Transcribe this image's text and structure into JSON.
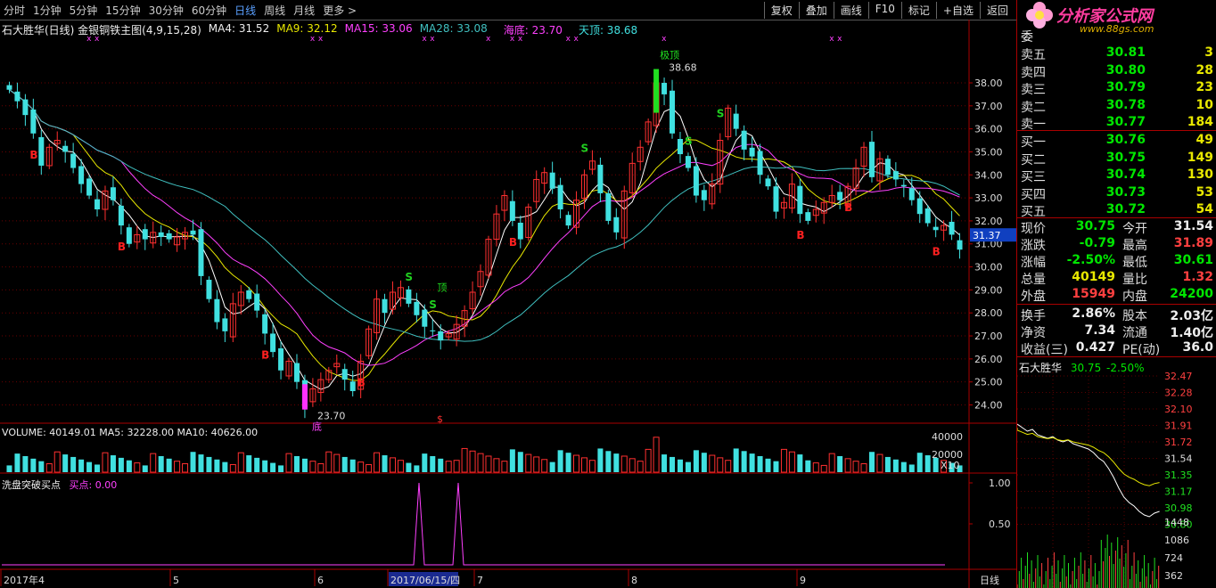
{
  "toolbar": {
    "periods": [
      "分时",
      "1分钟",
      "5分钟",
      "15分钟",
      "30分钟",
      "60分钟",
      "日线",
      "周线",
      "月线",
      "更多 >"
    ],
    "active_period": "日线",
    "buttons": [
      "复权",
      "叠加",
      "画线",
      "F10",
      "标记",
      "+自选",
      "返回"
    ]
  },
  "info": {
    "title": "石大胜华(日线) 金银铜铁主图(4,9,15,28)",
    "ma4": "MA4: 31.52",
    "ma9": "MA9: 32.12",
    "ma15": "MA15: 33.06",
    "ma28": "MA28: 33.08",
    "bottom": "海底: 23.70",
    "top": "天顶: 38.68"
  },
  "colors": {
    "up": "#ff3030",
    "down": "#40e0e0",
    "ma4": "#ffffff",
    "ma9": "#e8e800",
    "ma15": "#ff40ff",
    "ma28": "#40c0c0",
    "buy": "#ff2020",
    "sell": "#20d020"
  },
  "annotations": {
    "high_label": "38.68",
    "low_label": "23.70",
    "top_tag": "顶",
    "top_tag2": "极顶",
    "bottom_tag": "底",
    "current_price_tag": "31.37",
    "dollar_mark": "$"
  },
  "volume_info": {
    "text": "VOLUME: 40149.01  MA5: 32228.00  MA10: 40626.00",
    "ticks": [
      "40000",
      "20000",
      "X10"
    ]
  },
  "indicator_info": {
    "name": "洗盘突破买点",
    "value": "买点: 0.00",
    "ticks": [
      "1.00",
      "0.50"
    ]
  },
  "date_axis": {
    "labels": [
      "2017年4",
      "5",
      "6",
      "2017/06/15/四",
      "7",
      "8",
      "9"
    ],
    "period_label": "日线"
  },
  "chart_data": {
    "type": "candlestick",
    "y_axis_ticks": [
      "38.00",
      "37.00",
      "36.00",
      "35.00",
      "34.00",
      "33.00",
      "32.00",
      "31.00",
      "30.00",
      "29.00",
      "28.00",
      "27.00",
      "26.00",
      "25.00",
      "24.00"
    ],
    "ylim": [
      23.4,
      39.2
    ],
    "high": 38.68,
    "low": 23.7,
    "last_close": 30.75,
    "closes": [
      37.7,
      37.2,
      36.6,
      35.8,
      34.4,
      35.2,
      35.5,
      35.0,
      34.3,
      33.6,
      33.1,
      32.5,
      33.3,
      32.9,
      31.8,
      31.0,
      31.4,
      31.2,
      31.5,
      31.3,
      31.2,
      31.3,
      31.5,
      31.4,
      29.6,
      28.6,
      27.6,
      27.2,
      28.4,
      28.9,
      28.6,
      28.1,
      27.1,
      26.3,
      25.5,
      25.9,
      25.0,
      23.9,
      24.7,
      25.1,
      25.5,
      25.8,
      25.1,
      24.6,
      25.9,
      27.3,
      28.6,
      28.0,
      28.9,
      29.1,
      28.4,
      27.9,
      27.4,
      27.2,
      26.8,
      27.1,
      27.5,
      28.1,
      28.9,
      29.8,
      31.2,
      32.3,
      33.1,
      32.0,
      31.2,
      32.6,
      33.8,
      34.1,
      33.4,
      32.5,
      31.8,
      32.9,
      34.0,
      34.6,
      33.2,
      32.0,
      31.5,
      33.3,
      34.5,
      35.2,
      36.3,
      38.0,
      37.5,
      35.8,
      34.9,
      34.3,
      33.1,
      32.9,
      33.6,
      35.5,
      36.9,
      36.0,
      35.1,
      34.8,
      34.0,
      33.5,
      32.4,
      32.8,
      33.6,
      32.3,
      32.0,
      32.5,
      32.8,
      33.1,
      32.9,
      33.5,
      34.3,
      35.2,
      33.9,
      34.7,
      34.0,
      33.8,
      33.5,
      32.9,
      32.3,
      31.9,
      31.6,
      31.8,
      31.4,
      30.75
    ],
    "buy_marks_index": [
      3,
      14,
      32,
      44,
      63,
      99,
      105,
      116
    ],
    "sell_marks_index": [
      50,
      53,
      72,
      85,
      89
    ],
    "volume_max": 40000,
    "indicator_spike_index": [
      66,
      68
    ]
  },
  "right_panel": {
    "logo_text": "分析家公式网",
    "logo_url": "www.88gs.com",
    "header_char": "委",
    "sell_orders": [
      {
        "label": "卖五",
        "price": "30.81",
        "vol": "3"
      },
      {
        "label": "卖四",
        "price": "30.80",
        "vol": "28"
      },
      {
        "label": "卖三",
        "price": "30.79",
        "vol": "23"
      },
      {
        "label": "卖二",
        "price": "30.78",
        "vol": "10"
      },
      {
        "label": "卖一",
        "price": "30.77",
        "vol": "184"
      }
    ],
    "buy_orders": [
      {
        "label": "买一",
        "price": "30.76",
        "vol": "49"
      },
      {
        "label": "买二",
        "price": "30.75",
        "vol": "149"
      },
      {
        "label": "买三",
        "price": "30.74",
        "vol": "130"
      },
      {
        "label": "买四",
        "price": "30.73",
        "vol": "53"
      },
      {
        "label": "买五",
        "price": "30.72",
        "vol": "54"
      }
    ],
    "quotes": [
      {
        "l1": "现价",
        "v1": "30.75",
        "c1": "green",
        "l2": "今开",
        "v2": "31.54",
        "c2": "white"
      },
      {
        "l1": "涨跌",
        "v1": "-0.79",
        "c1": "green",
        "l2": "最高",
        "v2": "31.89",
        "c2": "red"
      },
      {
        "l1": "涨幅",
        "v1": "-2.50%",
        "c1": "green",
        "l2": "最低",
        "v2": "30.61",
        "c2": "green"
      },
      {
        "l1": "总量",
        "v1": "40149",
        "c1": "yellow",
        "l2": "量比",
        "v2": "1.32",
        "c2": "red"
      },
      {
        "l1": "外盘",
        "v1": "15949",
        "c1": "red",
        "l2": "内盘",
        "v2": "24200",
        "c2": "green"
      }
    ],
    "quotes2": [
      {
        "l1": "换手",
        "v1": "2.86%",
        "c1": "white",
        "l2": "股本",
        "v2": "2.03亿",
        "c2": "white"
      },
      {
        "l1": "净资",
        "v1": "7.34",
        "c1": "white",
        "l2": "流通",
        "v2": "1.40亿",
        "c2": "white"
      },
      {
        "l1": "收益(三)",
        "v1": "0.427",
        "c1": "white",
        "l2": "PE(动)",
        "v2": "36.0",
        "c2": "white"
      }
    ],
    "mini_title": "石大胜华",
    "mini_price": "30.75",
    "mini_change": "-2.50%",
    "mini_ticks": [
      "32.47",
      "32.28",
      "32.10",
      "31.91",
      "31.72",
      "31.54",
      "31.35",
      "31.17",
      "30.98",
      "30.80"
    ],
    "mini_vol_ticks": [
      "1448",
      "1086",
      "724",
      "362"
    ]
  }
}
